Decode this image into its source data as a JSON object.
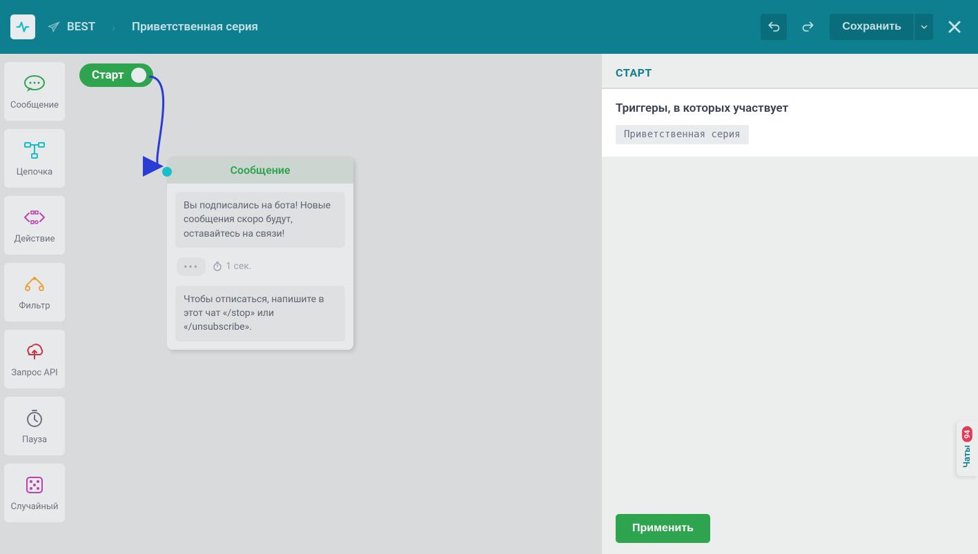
{
  "header": {
    "bot_name": "BEST",
    "flow_name": "Приветственная серия",
    "save_label": "Сохранить"
  },
  "sidebar": {
    "items": [
      {
        "label": "Сообщение",
        "icon": "message"
      },
      {
        "label": "Цепочка",
        "icon": "chain"
      },
      {
        "label": "Действие",
        "icon": "action"
      },
      {
        "label": "Фильтр",
        "icon": "filter"
      },
      {
        "label": "Запрос API",
        "icon": "cloud"
      },
      {
        "label": "Пауза",
        "icon": "clock"
      },
      {
        "label": "Случайный",
        "icon": "dice"
      }
    ]
  },
  "canvas": {
    "start_label": "Старт",
    "message_node": {
      "title": "Сообщение",
      "block1": "Вы подписались на бота! Новые сообщения скоро будут, оставайтесь на связи!",
      "timing": "1 сек.",
      "block2": "Чтобы отписаться, напишите в этот чат «/stop» или «/unsubscribe»."
    }
  },
  "panel": {
    "title": "СТАРТ",
    "section_title": "Триггеры, в которых участвует",
    "trigger_name": "Приветственная серия",
    "apply_label": "Применить"
  },
  "chat_widget": {
    "badge": "94",
    "label": "Чаты"
  }
}
